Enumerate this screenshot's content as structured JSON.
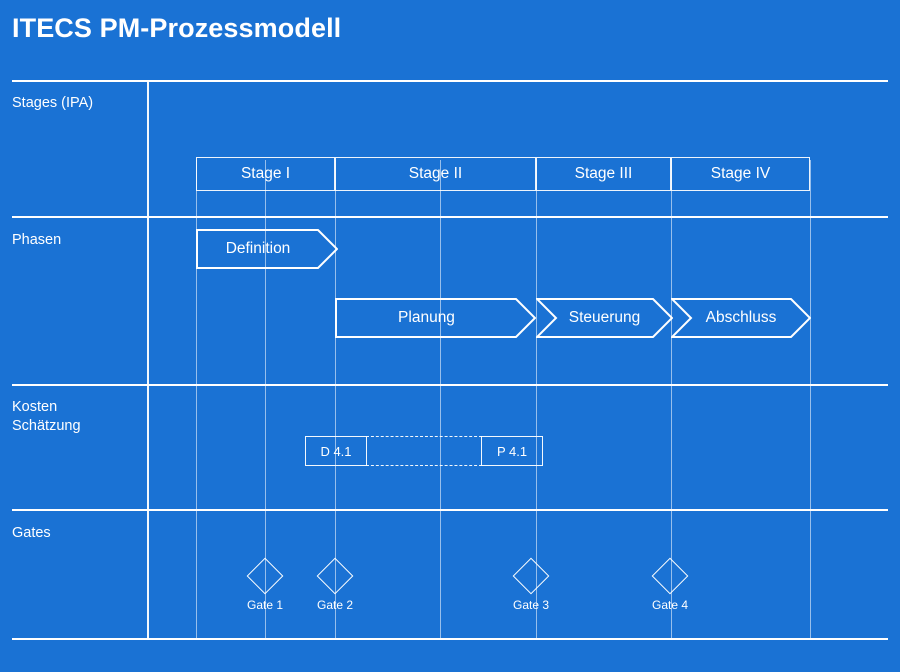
{
  "title": "ITECS PM-Prozessmodell",
  "colors": {
    "background": "#1a72d4",
    "line": "#ffffff",
    "text": "#ffffff"
  },
  "rows": [
    {
      "label": "Stages (IPA)"
    },
    {
      "label": "Phasen"
    },
    {
      "label": "Kosten\nSchätzung"
    },
    {
      "label": "Gates"
    }
  ],
  "stages": [
    {
      "label": "Stage I"
    },
    {
      "label": "Stage II"
    },
    {
      "label": "Stage III"
    },
    {
      "label": "Stage IV"
    }
  ],
  "phases": [
    {
      "label": "Definition"
    },
    {
      "label": "Planung"
    },
    {
      "label": "Steuerung"
    },
    {
      "label": "Abschluss"
    }
  ],
  "cost_estimation": {
    "start_label": "D 4.1",
    "end_label": "P 4.1"
  },
  "gates": [
    {
      "label": "Gate 1"
    },
    {
      "label": "Gate 2"
    },
    {
      "label": "Gate 3"
    },
    {
      "label": "Gate 4"
    }
  ]
}
